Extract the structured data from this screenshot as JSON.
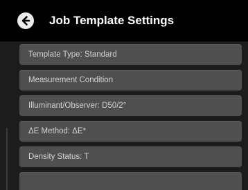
{
  "header": {
    "title": "Job Template Settings",
    "back_icon": "arrow-left-circle-icon"
  },
  "settings": {
    "items": [
      {
        "label": "Template Type: Standard"
      },
      {
        "label": "Measurement Condition"
      },
      {
        "label": "Illuminant/Observer: D50/2°"
      },
      {
        "label": "ΔE Method: ΔE*"
      },
      {
        "label": "Density Status: T"
      }
    ]
  },
  "colors": {
    "background": "#000000",
    "panel": "#1c1c1c",
    "row": "#4f4f4f",
    "row_text": "#d2d2d2",
    "title_text": "#ffffff",
    "back_button": "#ececec"
  }
}
